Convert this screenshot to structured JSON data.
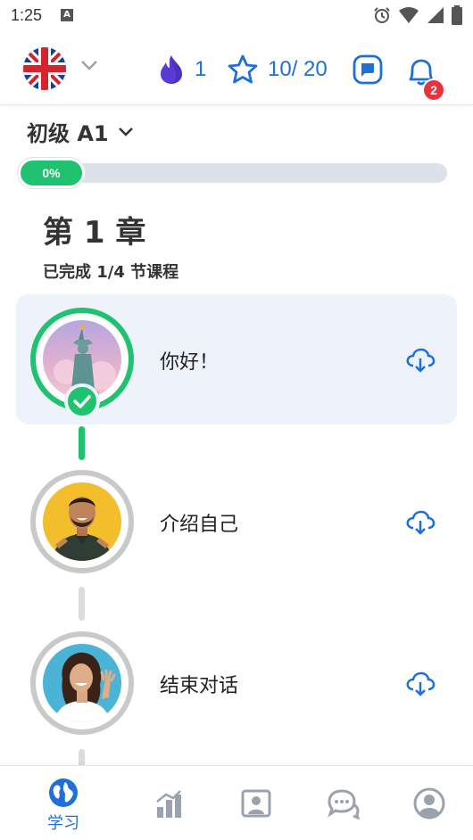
{
  "status_bar": {
    "time": "1:25",
    "a_icon_letter": "A"
  },
  "header": {
    "language_flag": "uk-flag-icon",
    "streak_count": "1",
    "stars_count": "10/ 20",
    "notification_count": "2"
  },
  "level": {
    "title": "初级 A1",
    "progress_label": "0%",
    "progress": 0.0
  },
  "chapter": {
    "title": "第 1 章",
    "subtitle": "已完成 1/4 节课程"
  },
  "lessons": [
    {
      "label": "你好！",
      "completed": true
    },
    {
      "label": "介绍自己",
      "completed": false
    },
    {
      "label": "结束对话",
      "completed": false
    }
  ],
  "bottom_nav": {
    "learn_label": "学习",
    "items": [
      "globe-icon",
      "stats-icon",
      "profile-card-icon",
      "chat-bubbles-icon",
      "account-icon"
    ]
  },
  "colors": {
    "accent_blue": "#1e6fd8",
    "success_green": "#1fc26e",
    "badge_red": "#e8323c",
    "inactive_gray": "#c9c9c9"
  }
}
